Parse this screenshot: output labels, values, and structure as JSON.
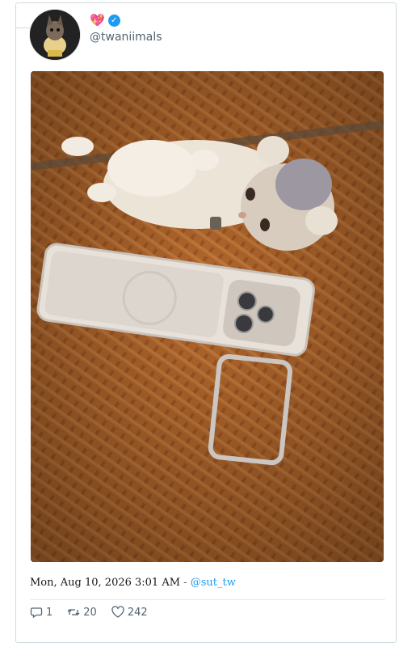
{
  "account": {
    "handle": "@twaniimals",
    "badge_emoji": "💖",
    "verified_mark": "✓"
  },
  "media": {
    "alt": "Fluffy kitten lying on a woven mat next to a phone on a stand",
    "mat_color": "#b76a2f"
  },
  "tweet": {
    "date_time": "Mon, Aug 10, 2026 3:01 AM",
    "separator": " - ",
    "via": "@sut_tw"
  },
  "stats": {
    "replies": "1",
    "retweets": "20",
    "likes": "242"
  },
  "colors": {
    "accent": "#1d9bf0",
    "muted": "#536471",
    "border": "#cfd9de"
  }
}
